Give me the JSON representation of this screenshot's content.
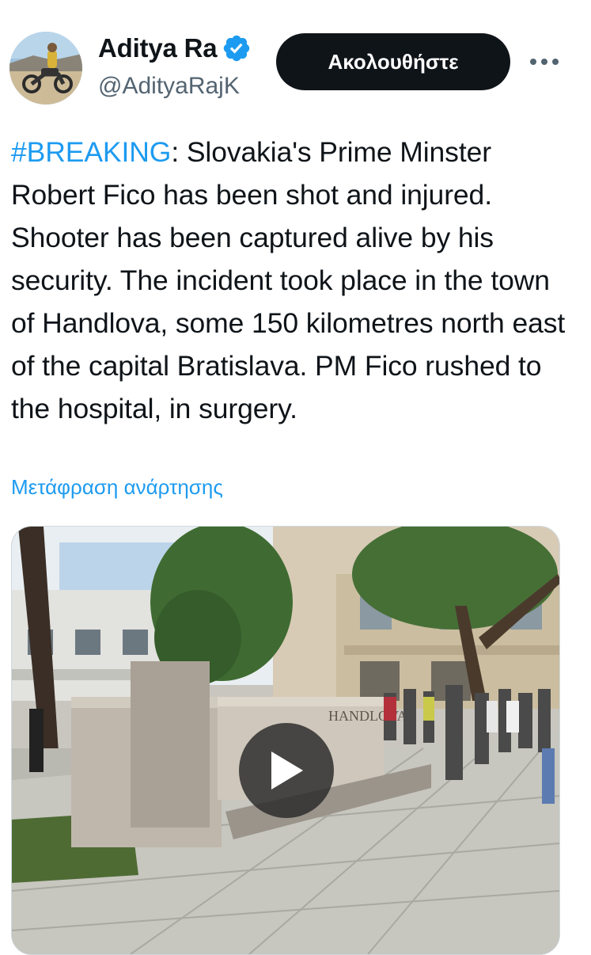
{
  "tweet": {
    "author": {
      "display_name": "Aditya Ra",
      "handle": "@AdityaRajK",
      "verified": true,
      "avatar_icon": "motorcycle-rider-avatar"
    },
    "follow_label": "Ακολουθήστε",
    "more_icon": "ellipsis-icon",
    "text": {
      "hashtag": "#BREAKING",
      "body": ": Slovakia's Prime Minster Robert Fico has been shot and injured. Shooter has been captured alive by his security. The incident took place in the town of Handlova, some 150 kilometres north east of the capital Bratislava. PM Fico rushed to the hospital, in surgery."
    },
    "translate_label": "Μετάφραση ανάρτησης",
    "media": {
      "type": "video",
      "play_icon": "play-icon",
      "sign_text": "HANDLOVA"
    }
  },
  "colors": {
    "link": "#1d9bf0",
    "text": "#0f1419",
    "secondary": "#536471",
    "button_bg": "#0f1419"
  }
}
